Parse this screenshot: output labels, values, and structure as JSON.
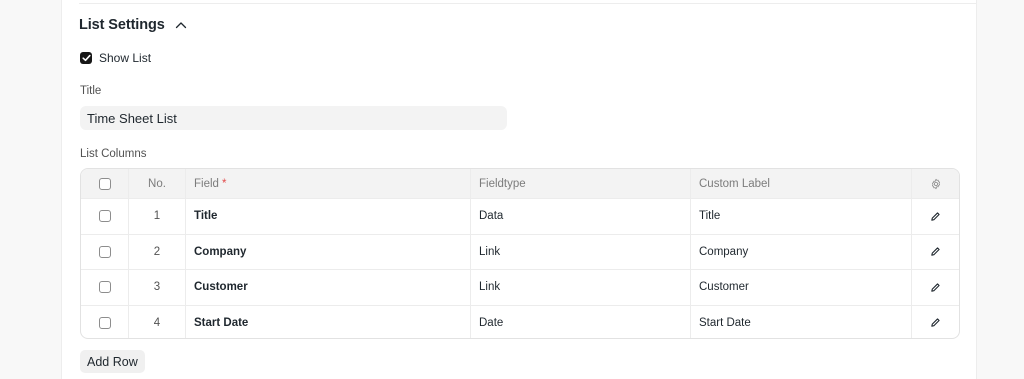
{
  "section": {
    "title": "List Settings",
    "collapse_icon": "chevron-up-icon"
  },
  "show_list": {
    "label": "Show List",
    "checked": true
  },
  "title_field": {
    "label": "Title",
    "value": "Time Sheet List"
  },
  "list_columns": {
    "label": "List Columns",
    "headers": {
      "no": "No.",
      "field": "Field",
      "required_mark": "*",
      "fieldtype": "Fieldtype",
      "custom_label": "Custom Label"
    },
    "rows": [
      {
        "no": "1",
        "field": "Title",
        "fieldtype": "Data",
        "custom_label": "Title"
      },
      {
        "no": "2",
        "field": "Company",
        "fieldtype": "Link",
        "custom_label": "Company"
      },
      {
        "no": "3",
        "field": "Customer",
        "fieldtype": "Link",
        "custom_label": "Customer"
      },
      {
        "no": "4",
        "field": "Start Date",
        "fieldtype": "Date",
        "custom_label": "Start Date"
      }
    ]
  },
  "add_row_label": "Add Row",
  "colors": {
    "required": "#e24c4c",
    "text": "#1f272e",
    "muted": "#7c7c7c",
    "checkbox_checked": "#171717"
  }
}
